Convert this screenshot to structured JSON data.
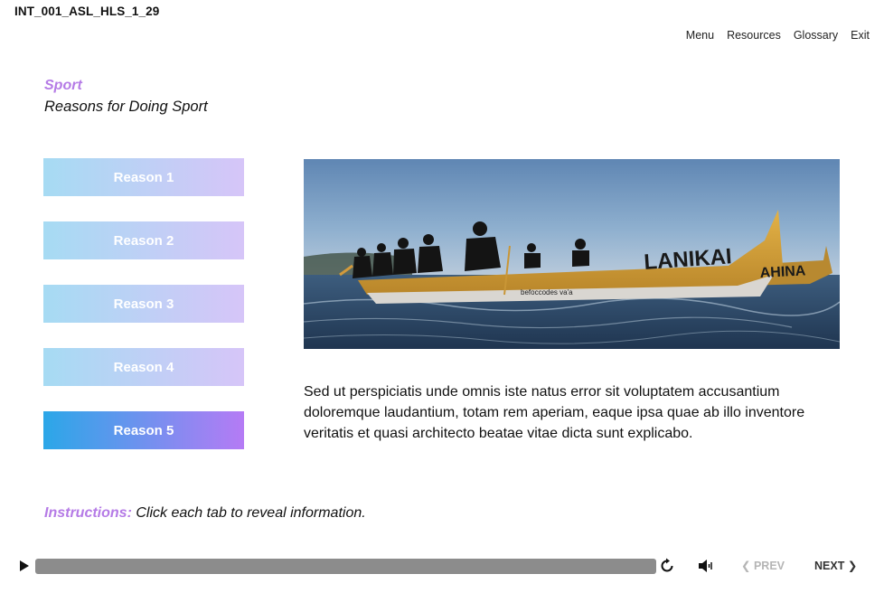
{
  "header": {
    "course_id": "INT_001_ASL_HLS_1_29",
    "nav": {
      "menu": "Menu",
      "resources": "Resources",
      "glossary": "Glossary",
      "exit": "Exit"
    }
  },
  "slide": {
    "title": "Sport",
    "subtitle": "Reasons for Doing Sport",
    "tabs": [
      {
        "label": "Reason 1",
        "active": false
      },
      {
        "label": "Reason 2",
        "active": false
      },
      {
        "label": "Reason 3",
        "active": false
      },
      {
        "label": "Reason 4",
        "active": false
      },
      {
        "label": "Reason 5",
        "active": true
      }
    ],
    "image": {
      "canoe_name_front": "LANIKAI",
      "canoe_name_back": "AHINA",
      "hull_text": "befoccodes va'a"
    },
    "body_text": "Sed ut perspiciatis unde omnis iste natus error sit voluptatem accusantium doloremque laudantium, totam rem aperiam, eaque ipsa quae ab illo inventore veritatis et quasi architecto beatae vitae dicta sunt explicabo.",
    "instructions_label": "Instructions:",
    "instructions_text": "Click each tab to reveal information."
  },
  "player": {
    "prev_label": "PREV",
    "next_label": "NEXT",
    "prev_enabled": false,
    "icons": [
      "play-icon",
      "replay-icon",
      "volume-icon",
      "chevron-left-icon",
      "chevron-right-icon"
    ]
  },
  "colors": {
    "accent_purple": "#b57be6",
    "tab_gradient_start": "#a6dbf3",
    "tab_gradient_end": "#d6c5f8",
    "active_gradient_start": "#2ba7e8",
    "active_gradient_end": "#b57bf5",
    "seekbar": "#8c8c8c"
  }
}
